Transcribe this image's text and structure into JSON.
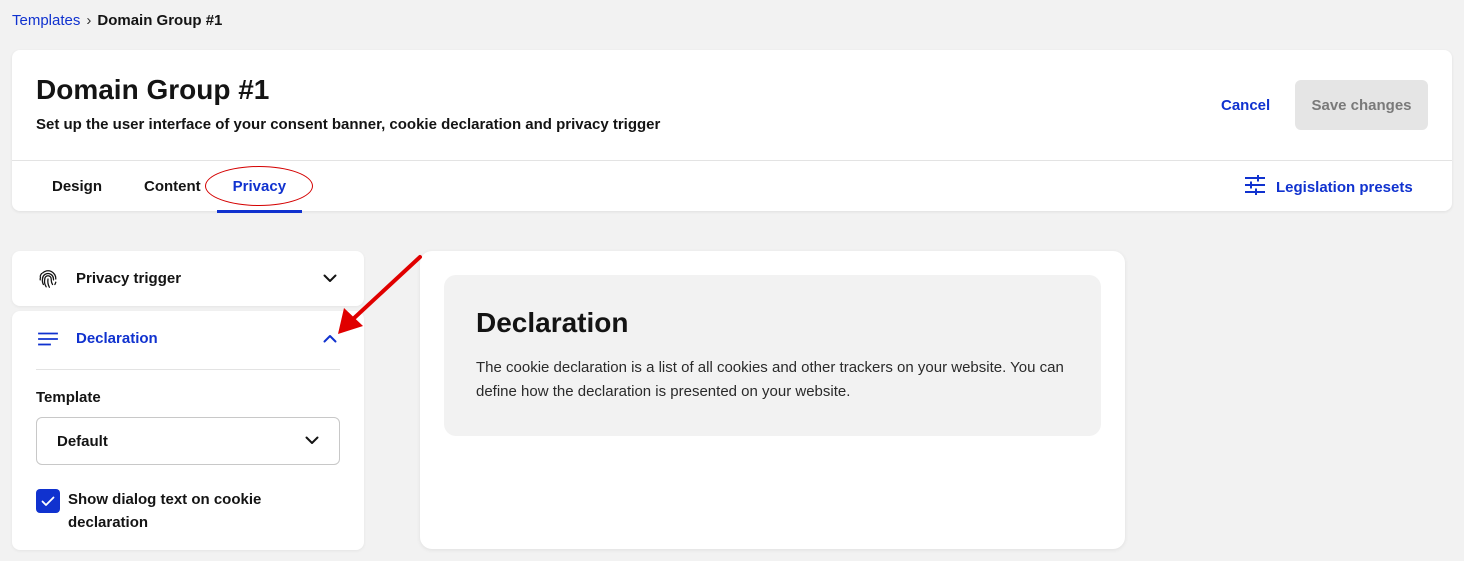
{
  "breadcrumb": {
    "parent": "Templates",
    "separator": "›",
    "current": "Domain Group #1"
  },
  "header": {
    "title": "Domain Group #1",
    "subtitle": "Set up the user interface of your consent banner, cookie declaration and privacy trigger",
    "cancel_label": "Cancel",
    "save_label": "Save changes"
  },
  "tabs": [
    {
      "label": "Design",
      "active": false
    },
    {
      "label": "Content",
      "active": false
    },
    {
      "label": "Privacy",
      "active": true
    }
  ],
  "legislation_presets": {
    "label": "Legislation presets",
    "icon": "sliders-icon"
  },
  "sidebar": {
    "privacy_trigger": {
      "label": "Privacy trigger",
      "icon": "fingerprint-icon",
      "expanded": false
    },
    "declaration": {
      "label": "Declaration",
      "icon": "lines-icon",
      "expanded": true,
      "template_label": "Template",
      "template_value": "Default",
      "checkbox_label": "Show dialog text on cookie declaration",
      "checkbox_checked": true
    }
  },
  "preview": {
    "title": "Declaration",
    "text": "The cookie declaration is a list of all cookies and other trackers on your website. You can define how the declaration is presented on your website."
  },
  "colors": {
    "accent": "#1032cf",
    "annotation": "#e00000",
    "background": "#f2f2f2"
  }
}
